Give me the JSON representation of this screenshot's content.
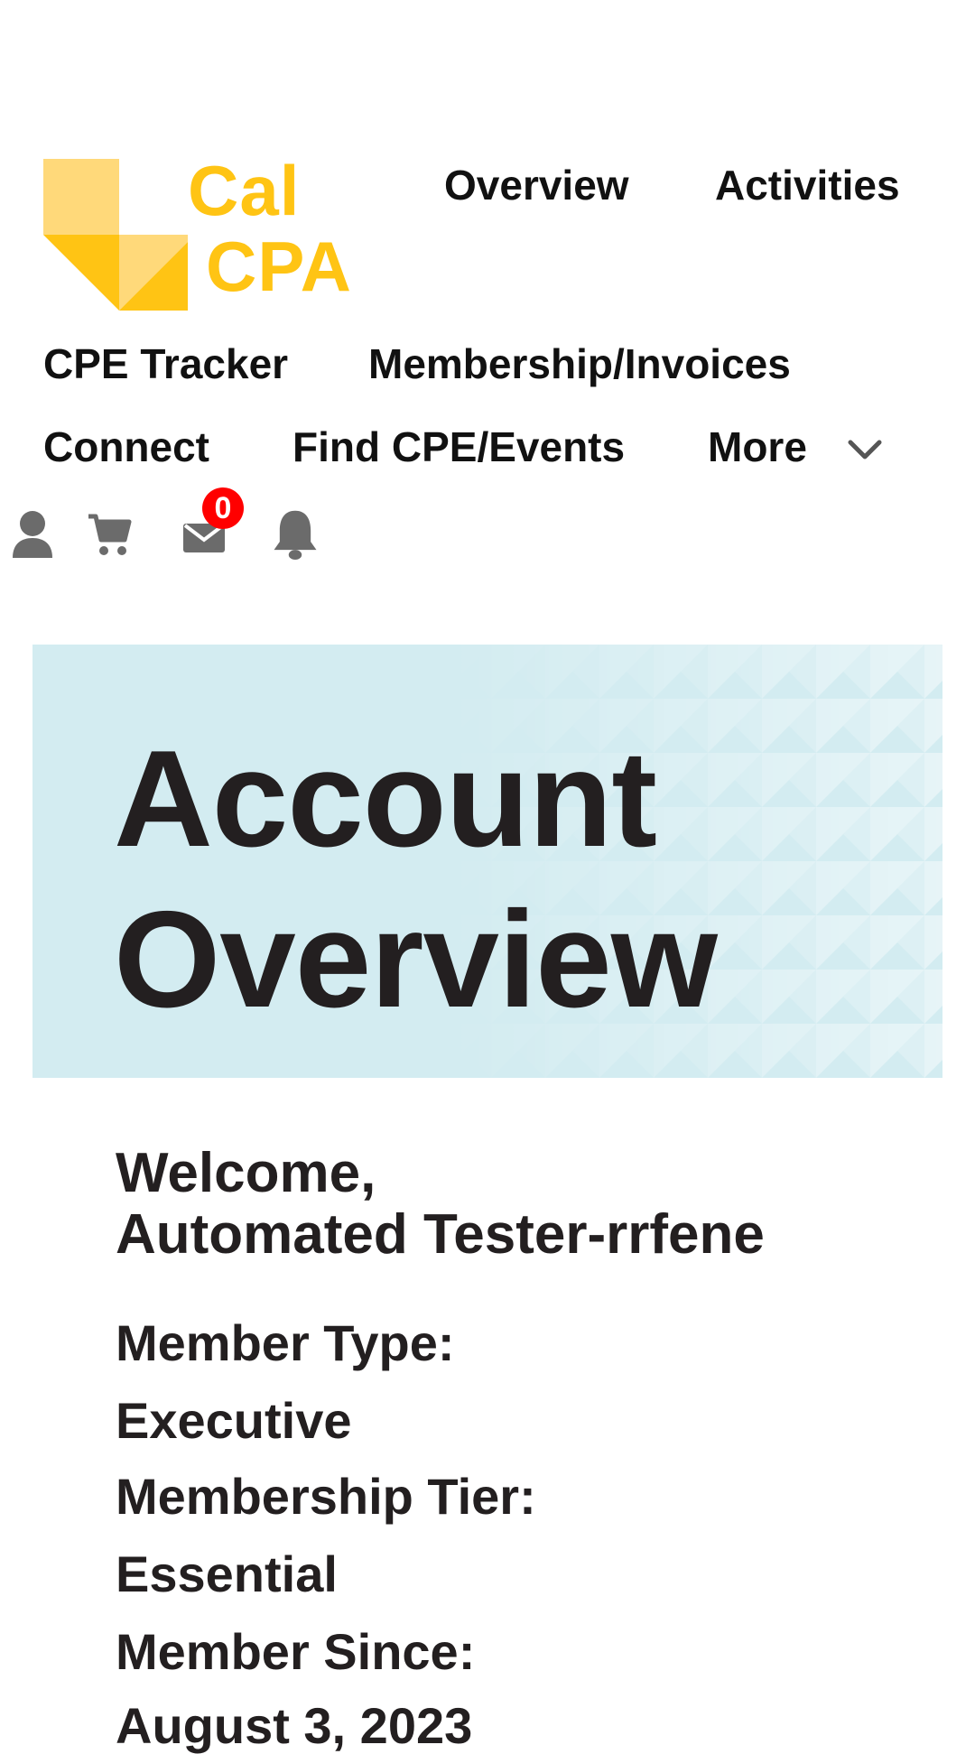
{
  "header": {
    "logo": {
      "line1": "Cal",
      "line2": "CPA",
      "primary_color": "#ffc414",
      "light_color": "#ffd97a"
    },
    "nav": {
      "overview": "Overview",
      "activities": "Activities",
      "cpe_tracker": "CPE Tracker",
      "membership_invoices": "Membership/Invoices",
      "connect": "Connect",
      "find_cpe_events": "Find CPE/Events",
      "more": "More"
    },
    "utility_icons": [
      "user-icon",
      "cart-icon",
      "mail-icon",
      "bell-icon"
    ],
    "mail_badge_count": "0",
    "badge_color": "#ff0000",
    "icon_color": "#6b6b6b"
  },
  "hero": {
    "title_line1": "Account",
    "title_line2": "Overview",
    "background_color": "#d3ecf1"
  },
  "profile": {
    "welcome": "Welcome,",
    "name": "Automated Tester-rrfene",
    "member_type_label": "Member Type:",
    "member_type_value": "Executive",
    "membership_tier_label": "Membership Tier:",
    "membership_tier_value": "Essential",
    "member_since_label": "Member Since:",
    "member_since_value": "August 3, 2023"
  }
}
